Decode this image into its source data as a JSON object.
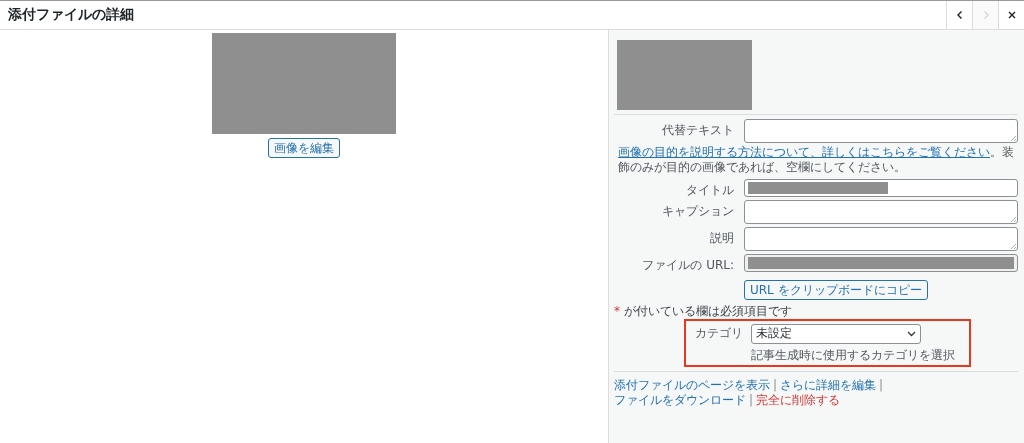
{
  "window": {
    "title": "添付ファイルの詳細",
    "nav": [
      {
        "kind": "prev",
        "disabled": false
      },
      {
        "kind": "next",
        "disabled": true
      },
      {
        "kind": "close",
        "disabled": false
      }
    ]
  },
  "preview": {
    "edit_button": "画像を編集"
  },
  "fields": [
    {
      "label": "代替テキスト",
      "kind": "textarea"
    },
    {
      "label": "タイトル",
      "kind": "redacted-input"
    },
    {
      "label": "キャプション",
      "kind": "textarea"
    },
    {
      "label": "説明",
      "kind": "textarea"
    },
    {
      "label": "ファイルの URL:",
      "kind": "redacted-readonly"
    }
  ],
  "alt_help": {
    "link": "画像の目的を説明する方法について、詳しくはこちらをご覧ください",
    "text": "。装飾のみが目的の画像であれば、空欄にしてください。"
  },
  "copy_button": "URL をクリップボードにコピー",
  "required_note": {
    "mark": "*",
    "text": "が付いている欄は必須項目です"
  },
  "category": {
    "label": "カテゴリ",
    "value": "未設定",
    "help": "記事生成時に使用するカテゴリを選択",
    "highlighted": true
  },
  "action_links": {
    "separator": "|",
    "items": [
      {
        "label": "添付ファイルのページを表示",
        "danger": false
      },
      {
        "label": "さらに詳細を編集",
        "danger": false
      },
      {
        "label": "ファイルをダウンロード",
        "danger": false
      },
      {
        "label": "完全に削除する",
        "danger": true
      }
    ]
  }
}
